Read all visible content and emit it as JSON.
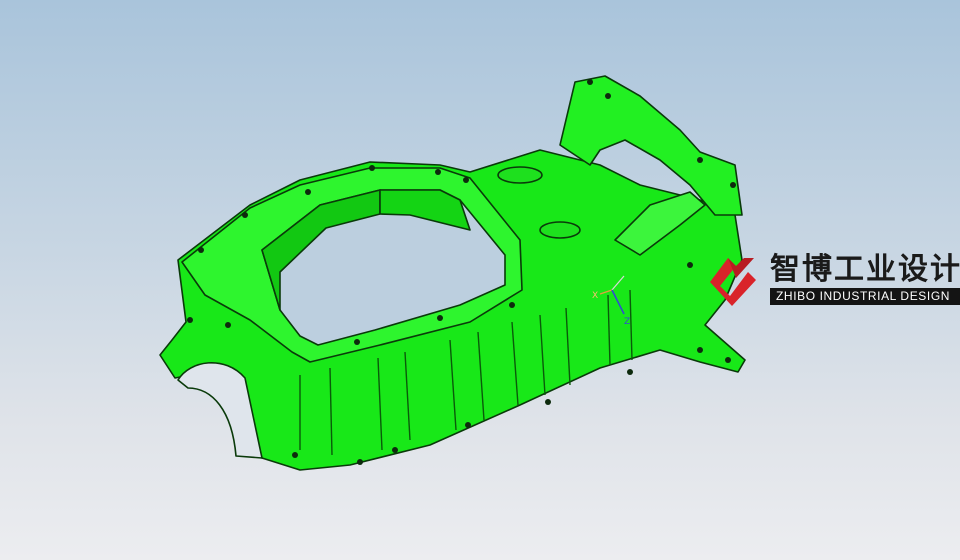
{
  "viewport": {
    "background_top": "#a9c4db",
    "background_bottom": "#ecedf0",
    "model_color": "#18e818",
    "model_edge_color": "#0a3a0a"
  },
  "triad": {
    "x_label": "X",
    "z_label": "Z"
  },
  "watermark": {
    "brand_cn": "智博工业设计",
    "brand_en": "ZHIBO INDUSTRIAL  DESIGN",
    "accent_color": "#d9232a",
    "text_color": "#1a1a1a"
  }
}
